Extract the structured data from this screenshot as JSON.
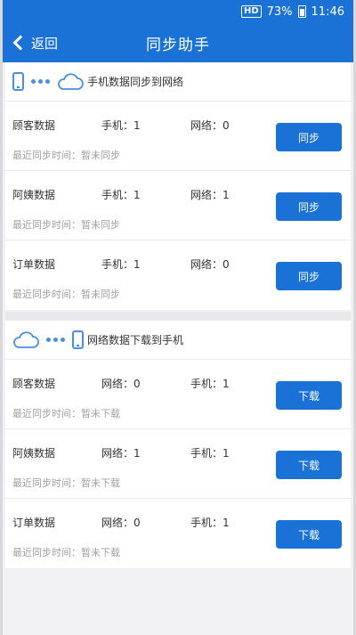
{
  "statusbar": {
    "hd": "HD",
    "battery": "73%",
    "time": "11:46"
  },
  "header": {
    "back_label": "返回",
    "title": "同步助手"
  },
  "upload": {
    "title": "手机数据同步到网络",
    "rows": [
      {
        "name": "顾客数据",
        "a": "手机：1",
        "b": "网络：0",
        "time": "最近同步时间：暂未同步",
        "button": "同步"
      },
      {
        "name": "阿姨数据",
        "a": "手机：1",
        "b": "网络：1",
        "time": "最近同步时间：暂未同步",
        "button": "同步"
      },
      {
        "name": "订单数据",
        "a": "手机：1",
        "b": "网络：0",
        "time": "最近同步时间：暂未同步",
        "button": "同步"
      }
    ]
  },
  "download": {
    "title": "网络数据下载到手机",
    "rows": [
      {
        "name": "顾客数据",
        "a": "网络：0",
        "b": "手机：1",
        "time": "最近同步时间：暂未下载",
        "button": "下载"
      },
      {
        "name": "阿姨数据",
        "a": "网络：1",
        "b": "手机：1",
        "time": "最近同步时间：暂未下载",
        "button": "下载"
      },
      {
        "name": "订单数据",
        "a": "网络：0",
        "b": "手机：1",
        "time": "最近同步时间：暂未下载",
        "button": "下载"
      }
    ]
  },
  "icons": [
    "phone-icon",
    "dots-icon",
    "cloud-icon",
    "back-chevron-icon",
    "battery-icon"
  ],
  "colors": {
    "primary": "#1a72d6",
    "icon_blue": "#4a8fdf",
    "muted_text": "#a0a0a0",
    "background": "#f2f2f4"
  }
}
